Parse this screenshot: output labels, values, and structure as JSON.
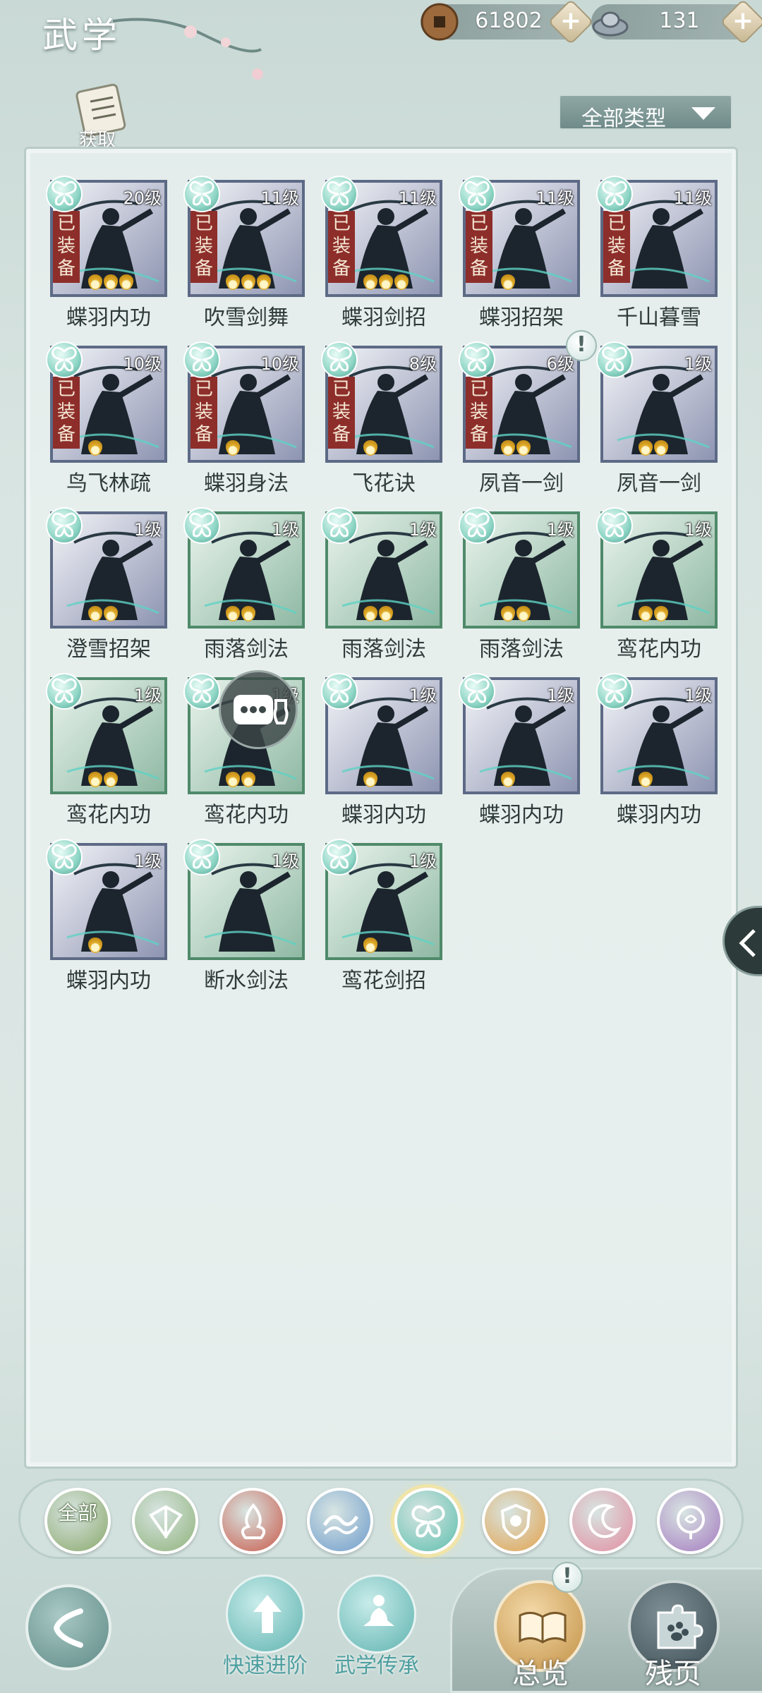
{
  "header": {
    "title": "武学",
    "coins": "61802",
    "silver": "131"
  },
  "acquire_label": "获取",
  "filter_label": "全部类型",
  "skills": [
    {
      "name": "蝶羽内功",
      "level": "20级",
      "equipped": true,
      "stars": 3,
      "frame": "purple"
    },
    {
      "name": "吹雪剑舞",
      "level": "11级",
      "equipped": true,
      "stars": 3,
      "frame": "purple"
    },
    {
      "name": "蝶羽剑招",
      "level": "11级",
      "equipped": true,
      "stars": 3,
      "frame": "purple"
    },
    {
      "name": "蝶羽招架",
      "level": "11级",
      "equipped": true,
      "stars": 1,
      "frame": "purple"
    },
    {
      "name": "千山暮雪",
      "level": "11级",
      "equipped": true,
      "stars": 0,
      "frame": "purple"
    },
    {
      "name": "鸟飞林疏",
      "level": "10级",
      "equipped": true,
      "stars": 1,
      "frame": "purple"
    },
    {
      "name": "蝶羽身法",
      "level": "10级",
      "equipped": true,
      "stars": 1,
      "frame": "purple"
    },
    {
      "name": "飞花诀",
      "level": "8级",
      "equipped": true,
      "stars": 1,
      "frame": "purple"
    },
    {
      "name": "夙音一剑",
      "level": "6级",
      "equipped": true,
      "stars": 2,
      "frame": "purple"
    },
    {
      "name": "夙音一剑",
      "level": "1级",
      "equipped": false,
      "stars": 2,
      "frame": "purple"
    },
    {
      "name": "澄雪招架",
      "level": "1级",
      "equipped": false,
      "stars": 2,
      "frame": "purple"
    },
    {
      "name": "雨落剑法",
      "level": "1级",
      "equipped": false,
      "stars": 2,
      "frame": "green"
    },
    {
      "name": "雨落剑法",
      "level": "1级",
      "equipped": false,
      "stars": 2,
      "frame": "green"
    },
    {
      "name": "雨落剑法",
      "level": "1级",
      "equipped": false,
      "stars": 2,
      "frame": "green"
    },
    {
      "name": "鸾花内功",
      "level": "1级",
      "equipped": false,
      "stars": 2,
      "frame": "green"
    },
    {
      "name": "鸾花内功",
      "level": "1级",
      "equipped": false,
      "stars": 2,
      "frame": "green"
    },
    {
      "name": "鸾花内功",
      "level": "1级",
      "equipped": false,
      "stars": 2,
      "frame": "green"
    },
    {
      "name": "蝶羽内功",
      "level": "1级",
      "equipped": false,
      "stars": 1,
      "frame": "purple"
    },
    {
      "name": "蝶羽内功",
      "level": "1级",
      "equipped": false,
      "stars": 1,
      "frame": "purple"
    },
    {
      "name": "蝶羽内功",
      "level": "1级",
      "equipped": false,
      "stars": 1,
      "frame": "purple"
    },
    {
      "name": "蝶羽内功",
      "level": "1级",
      "equipped": false,
      "stars": 1,
      "frame": "purple"
    },
    {
      "name": "断水剑法",
      "level": "1级",
      "equipped": false,
      "stars": 0,
      "frame": "green"
    },
    {
      "name": "鸾花剑招",
      "level": "1级",
      "equipped": false,
      "stars": 1,
      "frame": "green"
    }
  ],
  "equipped_label": "已装备",
  "categories": [
    {
      "id": "all",
      "label": "全部",
      "color": "#8aa86a"
    },
    {
      "id": "sword-gu",
      "color": "#8fb27a"
    },
    {
      "id": "flame",
      "color": "#c95a4a"
    },
    {
      "id": "wave",
      "color": "#6e9ccc"
    },
    {
      "id": "butterfly",
      "color": "#5dbfae"
    },
    {
      "id": "shield",
      "color": "#e3a24c"
    },
    {
      "id": "moon",
      "color": "#e28da0"
    },
    {
      "id": "rose",
      "color": "#a57bc0"
    }
  ],
  "nav": {
    "quick_advance": "快速进阶",
    "inheritance": "武学传承",
    "overview": "总览",
    "fragments": "残页"
  },
  "alert_symbol": "!"
}
